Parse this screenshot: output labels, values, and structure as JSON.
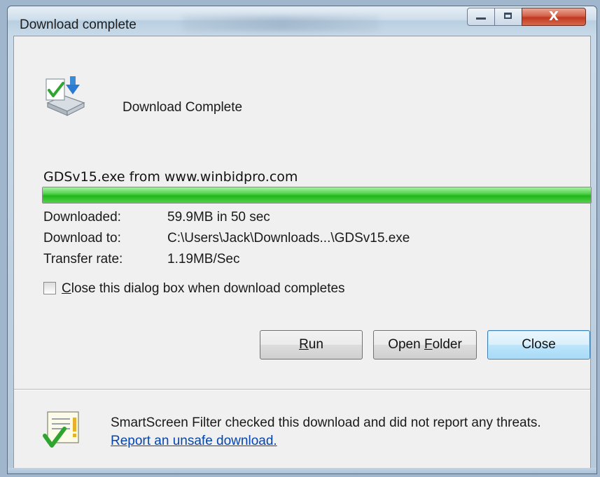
{
  "window": {
    "title": "Download complete"
  },
  "caption_buttons": {
    "minimize_icon": "minimize-icon",
    "maximize_icon": "maximize-icon",
    "close_glyph": "X"
  },
  "header": {
    "icon": "download-complete-icon",
    "heading": "Download Complete"
  },
  "download": {
    "filename_line": "GDSv15.exe from www.winbidpro.com",
    "progress_fraction": 1.0,
    "progress_color": "#21b71b",
    "details": [
      {
        "label": "Downloaded:",
        "value": "59.9MB in 50 sec"
      },
      {
        "label": "Download to:",
        "value": "C:\\Users\\Jack\\Downloads...\\GDSv15.exe"
      },
      {
        "label": "Transfer rate:",
        "value": "1.19MB/Sec"
      }
    ]
  },
  "options": {
    "close_when_complete": {
      "mnemonic": "C",
      "rest": "lose this dialog box when download completes",
      "checked": false
    }
  },
  "buttons": {
    "run": {
      "mnemonic": "R",
      "rest": "un"
    },
    "open_folder": {
      "prefix": "Open ",
      "mnemonic": "F",
      "rest": "older"
    },
    "close": {
      "label": "Close"
    }
  },
  "smartscreen": {
    "icon": "smartscreen-check-icon",
    "text": "SmartScreen Filter checked this download and did not report any threats. ",
    "link": "Report an unsafe download."
  }
}
